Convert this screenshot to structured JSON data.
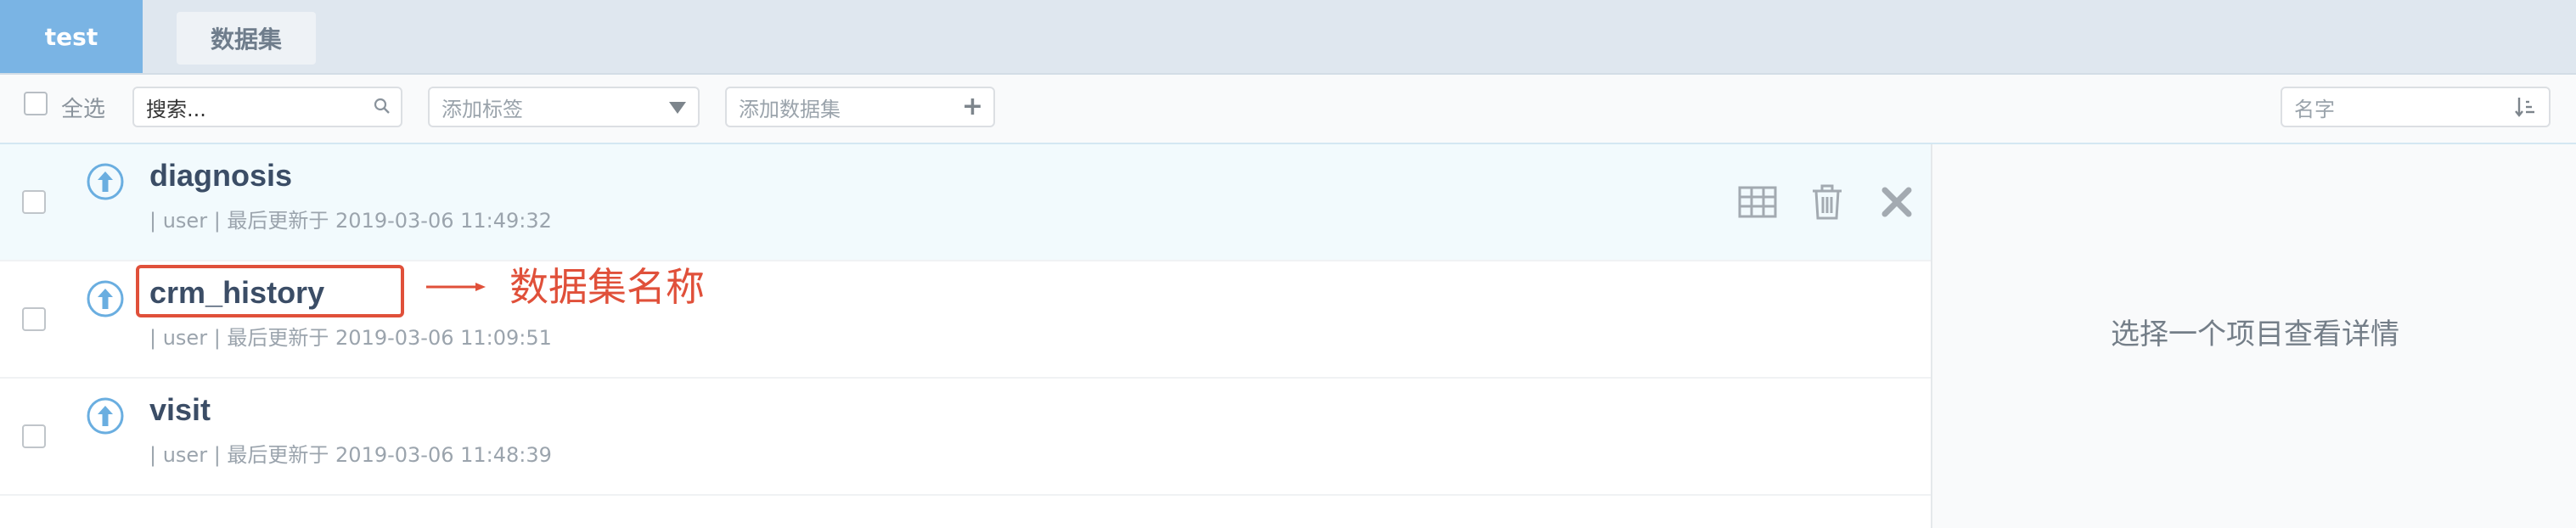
{
  "tabs": {
    "active_label": "test",
    "second_label": "数据集"
  },
  "toolbar": {
    "select_all_label": "全选",
    "search_value": "搜索...",
    "tag_placeholder": "添加标签",
    "add_dataset_placeholder": "添加数据集",
    "sort_placeholder": "名字"
  },
  "rows": [
    {
      "name": "diagnosis",
      "meta": "| user | 最后更新于 2019-03-06 11:49:32",
      "selected": true
    },
    {
      "name": "crm_history",
      "meta": "| user | 最后更新于 2019-03-06 11:09:51",
      "selected": false
    },
    {
      "name": "visit",
      "meta": "| user | 最后更新于 2019-03-06 11:48:39",
      "selected": false
    }
  ],
  "annotation": {
    "text": "数据集名称",
    "color": "#e0503a"
  },
  "detail": {
    "empty_message": "选择一个项目查看详情"
  },
  "colors": {
    "accent": "#7ab4e4",
    "upload_icon": "#6aaee0"
  },
  "icons": [
    "search-icon",
    "dropdown-arrow-icon",
    "plus-icon",
    "sort-icon",
    "upload-icon",
    "table-icon",
    "trash-icon",
    "close-icon"
  ]
}
